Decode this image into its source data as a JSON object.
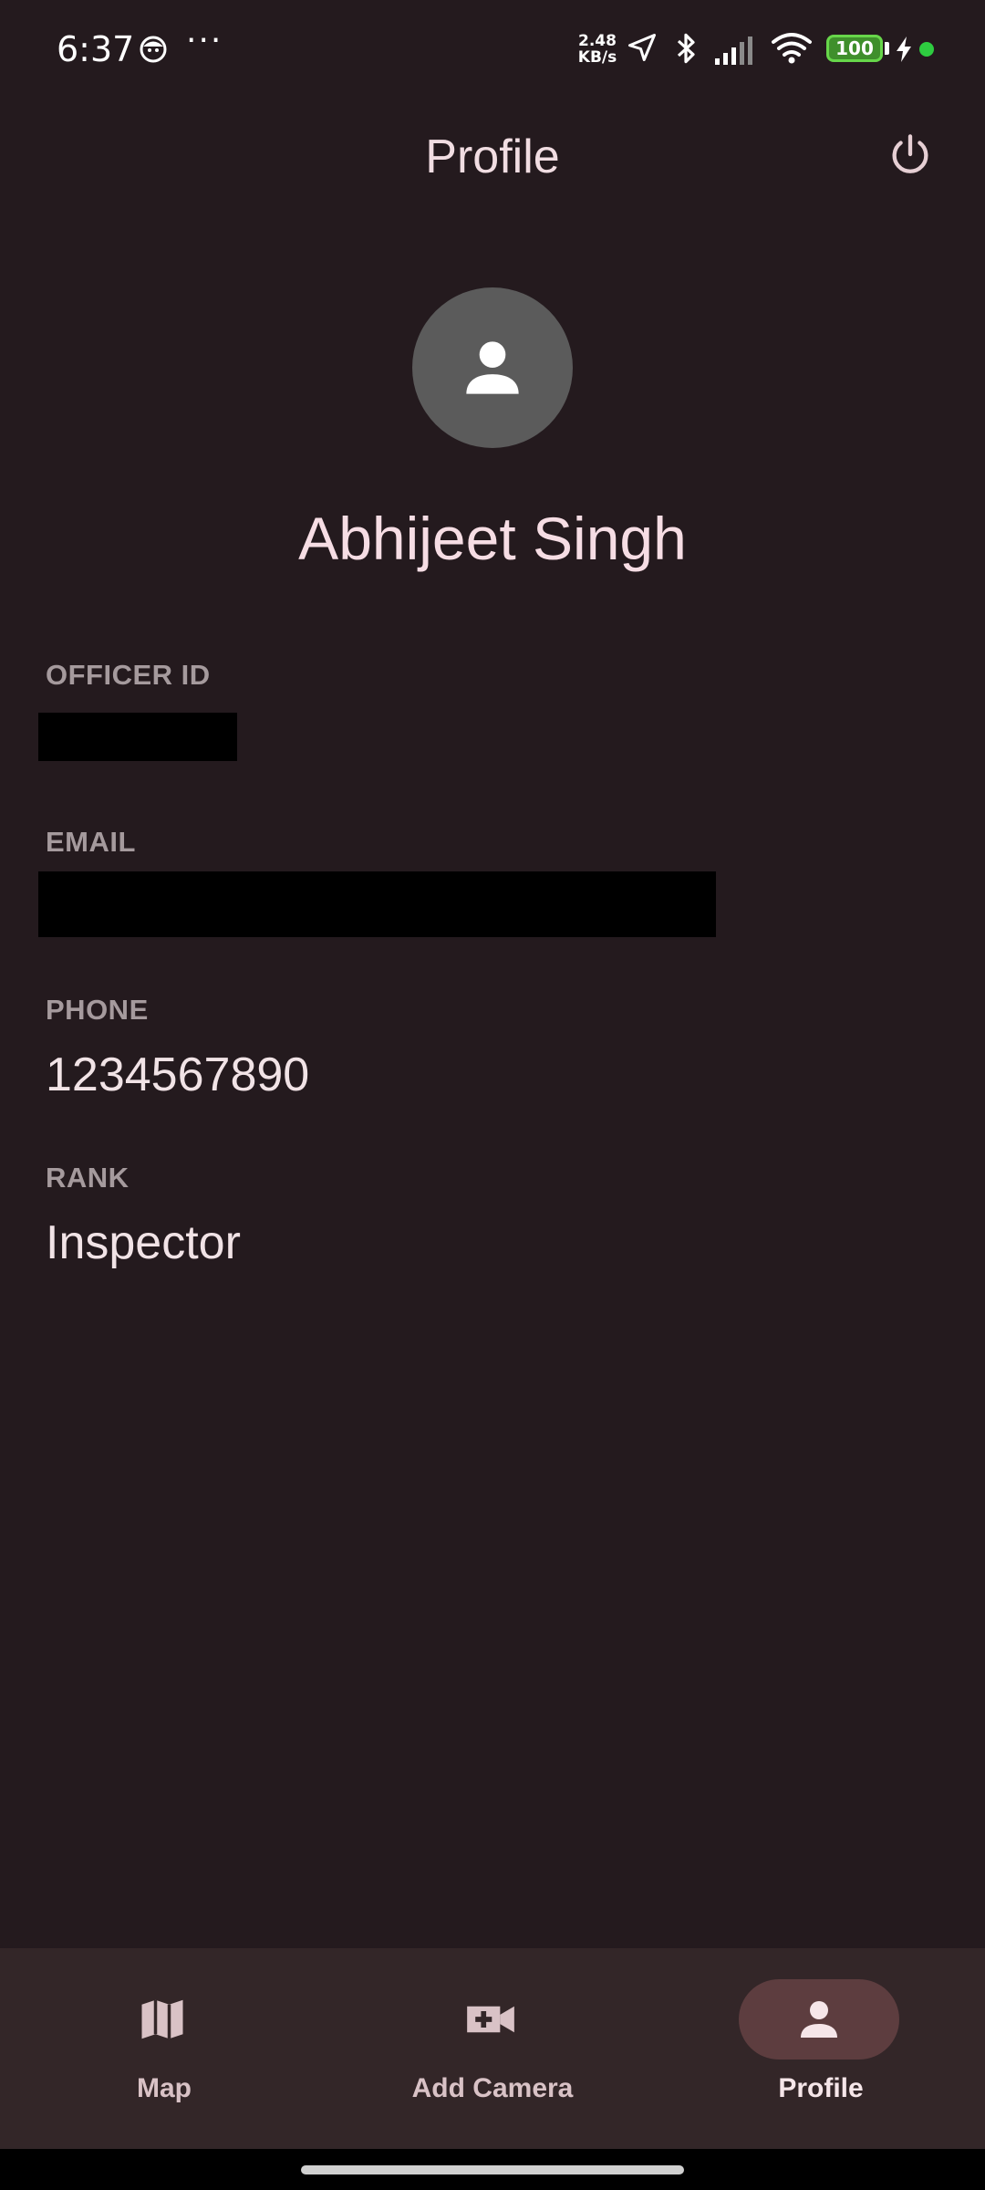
{
  "status_bar": {
    "time": "6:37",
    "more_indicator": "···",
    "network_speed_value": "2.48",
    "network_speed_unit": "KB/s",
    "battery_level": "100",
    "icons": [
      "face-notification-icon",
      "location-arrow-icon",
      "bluetooth-icon",
      "signal-bars-icon",
      "wifi-icon",
      "battery-icon",
      "charging-bolt-icon",
      "green-privacy-dot"
    ]
  },
  "app_bar": {
    "title": "Profile",
    "power_icon": "power-icon"
  },
  "profile": {
    "avatar_icon": "person-icon",
    "name": "Abhijeet Singh",
    "fields": {
      "officer_id_label": "OFFICER ID",
      "email_label": "EMAIL",
      "phone_label": "PHONE",
      "phone_value": "1234567890",
      "rank_label": "RANK",
      "rank_value": "Inspector"
    }
  },
  "bottom_nav": {
    "items": [
      {
        "label": "Map",
        "icon": "map-icon",
        "active": false
      },
      {
        "label": "Add Camera",
        "icon": "add-video-camera-icon",
        "active": false
      },
      {
        "label": "Profile",
        "icon": "person-icon",
        "active": true
      }
    ]
  },
  "colors": {
    "background": "#241a1e",
    "nav_background": "#332628",
    "active_pill": "#5d3d3f",
    "label_gray": "#a59a9d",
    "text_primary": "#f1dde2",
    "battery_green": "#3f8f2c"
  }
}
